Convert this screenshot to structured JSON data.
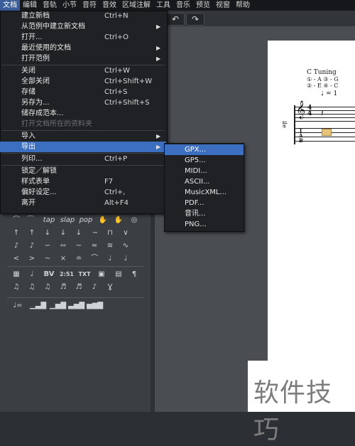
{
  "menubar": {
    "items": [
      "文档",
      "编辑",
      "音轨",
      "小节",
      "音符",
      "音效",
      "区域注解",
      "工具",
      "音乐",
      "预览",
      "视窗",
      "帮助"
    ]
  },
  "toolbar": {
    "undo_glyph": "↶",
    "redo_glyph": "↷"
  },
  "file_menu": {
    "items": [
      {
        "label": "建立新档",
        "shortcut": "Ctrl+N",
        "arrow": ""
      },
      {
        "label": "从范例中建立新文档",
        "shortcut": "",
        "arrow": "▶"
      },
      {
        "label": "打开...",
        "shortcut": "Ctrl+O",
        "arrow": ""
      },
      {
        "label": "最近使用的文档",
        "shortcut": "",
        "arrow": "▶"
      },
      {
        "label": "打开范例",
        "shortcut": "",
        "arrow": "▶"
      },
      {
        "label": "关闭",
        "shortcut": "Ctrl+W",
        "arrow": ""
      },
      {
        "label": "全部关闭",
        "shortcut": "Ctrl+Shift+W",
        "arrow": ""
      },
      {
        "label": "存储",
        "shortcut": "Ctrl+S",
        "arrow": ""
      },
      {
        "label": "另存为...",
        "shortcut": "Ctrl+Shift+S",
        "arrow": ""
      },
      {
        "label": "储存成范本...",
        "shortcut": "",
        "arrow": ""
      },
      {
        "label": "打开文档所在的资料夹",
        "shortcut": "",
        "arrow": ""
      },
      {
        "label": "导入",
        "shortcut": "",
        "arrow": "▶"
      },
      {
        "label": "导出",
        "shortcut": "",
        "arrow": "▶"
      },
      {
        "label": "列印...",
        "shortcut": "Ctrl+P",
        "arrow": ""
      },
      {
        "label": "锁定／解锁",
        "shortcut": "",
        "arrow": ""
      },
      {
        "label": "样式表单",
        "shortcut": "F7",
        "arrow": ""
      },
      {
        "label": "偏好设定...",
        "shortcut": "Ctrl+,",
        "arrow": ""
      },
      {
        "label": "离开",
        "shortcut": "Alt+F4",
        "arrow": ""
      }
    ]
  },
  "export_submenu": {
    "items": [
      "GPX...",
      "GP5...",
      "MIDI...",
      "ASCII...",
      "MusicXML...",
      "PDF...",
      "音讯...",
      "PNG..."
    ]
  },
  "score": {
    "tuning_title": "C Tuning",
    "tuning_row1": "① - A   ③ - G",
    "tuning_row2": "② - E   ④ - C",
    "tempo": "♩ = 1",
    "track_label": "ile",
    "tab_letters": "T\nA\nB"
  },
  "palette": {
    "row1": [
      "tap",
      "slap",
      "pop"
    ],
    "row6_text": [
      "BV",
      "2:51",
      "TXT"
    ]
  },
  "watermark": {
    "text": "软件技巧"
  }
}
